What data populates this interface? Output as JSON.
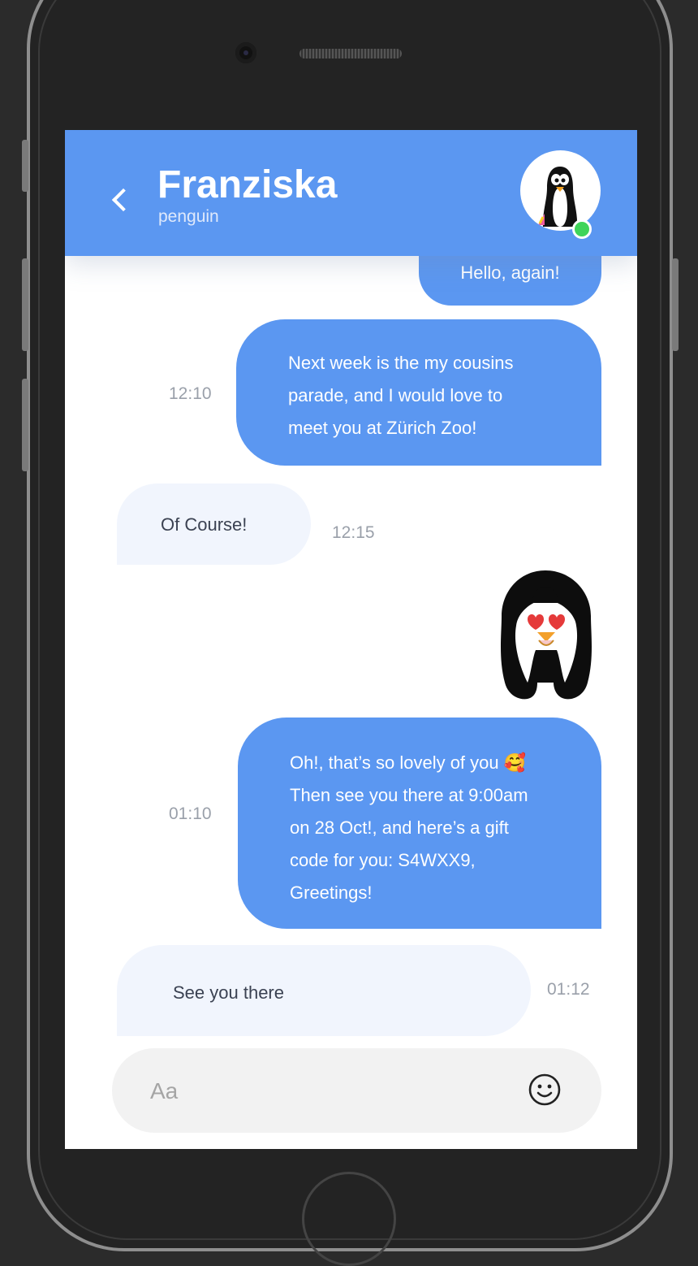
{
  "header": {
    "back_icon": "chevron-left-icon",
    "name": "Franziska",
    "subtitle": "penguin",
    "avatar": "penguin-avatar",
    "status": "online",
    "status_color": "#3fd45a",
    "accent_color": "#5b97f1"
  },
  "messages": [
    {
      "direction": "outgoing",
      "text": "Hello, again!",
      "time": ""
    },
    {
      "direction": "outgoing",
      "lines": [
        "Next week is the my cousins",
        "parade, and I would love to",
        "meet you at Zürich Zoo!"
      ],
      "time": "12:10"
    },
    {
      "direction": "incoming",
      "text": "Of Course!",
      "time": "12:15"
    },
    {
      "direction": "outgoing",
      "sticker": "penguin-heart-eyes-sticker"
    },
    {
      "direction": "outgoing",
      "lines": [
        "Oh!, that’s so lovely of you 🥰",
        "Then see you there at 9:00am",
        "on 28 Oct!, and here’s a gift",
        "code for you: S4WXX9,",
        "Greetings!"
      ],
      "time": "01:10"
    },
    {
      "direction": "incoming",
      "text": "See you there",
      "time": "01:12"
    }
  ],
  "composer": {
    "placeholder": "Aa",
    "emoji_icon": "smiley-icon"
  }
}
